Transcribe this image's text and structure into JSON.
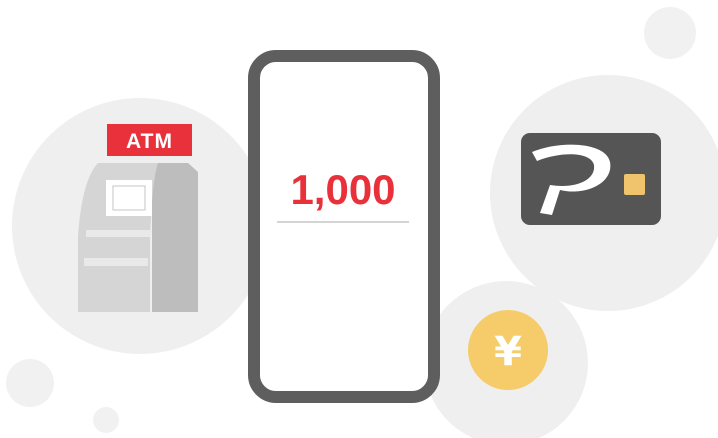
{
  "atm": {
    "label": "ATM"
  },
  "phone": {
    "amount": "1,000"
  },
  "coin": {
    "symbol": "¥"
  },
  "card": {
    "logo": "paypay-p-logo"
  },
  "colors": {
    "accent_red": "#e8313a",
    "circle_bg": "#efefef",
    "dot_bg": "#f1f1f1",
    "phone_frame": "#5e5e5e",
    "card_body": "#555555",
    "chip": "#f0c46c",
    "coin": "#f5cc69",
    "atm_body": "#d3d3d3",
    "atm_side": "#bdbdbd"
  }
}
